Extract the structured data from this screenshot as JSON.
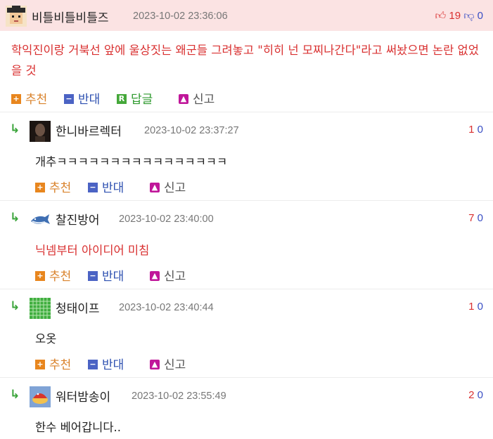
{
  "main_comment": {
    "nickname": "비틀비틀비틀즈",
    "date": "2023-10-02 23:36:06",
    "up_count": "19",
    "down_count": "0",
    "text": "학익진이랑 거북선 앞에 울상짓는 왜군들 그려놓고 \"히히 넌 모찌나간다\"라고 써놨으면 논란 없었을 것",
    "actions": {
      "recommend": "추천",
      "oppose": "반대",
      "reply": "답글",
      "report": "신고"
    }
  },
  "replies": [
    {
      "nickname": "한니바르렉터",
      "date": "2023-10-02 23:37:27",
      "up_count": "1",
      "down_count": "0",
      "text": "개추ㅋㅋㅋㅋㅋㅋㅋㅋㅋㅋㅋㅋㅋㅋㅋㅋ",
      "text_color": "#222222"
    },
    {
      "nickname": "찰진방어",
      "date": "2023-10-02 23:40:00",
      "up_count": "7",
      "down_count": "0",
      "text": "닉넴부터 아이디어 미침",
      "text_color": "#d93030"
    },
    {
      "nickname": "청태이프",
      "date": "2023-10-02 23:40:44",
      "up_count": "1",
      "down_count": "0",
      "text": "오옷",
      "text_color": "#222222"
    },
    {
      "nickname": "워터밤송이",
      "date": "2023-10-02 23:55:49",
      "up_count": "2",
      "down_count": "0",
      "text": "한수 베어갑니다..",
      "text_color": "#222222"
    }
  ],
  "reply_actions": {
    "recommend": "추천",
    "oppose": "반대",
    "report": "신고"
  },
  "colors": {
    "upvote": "#d93030",
    "downvote": "#3a4fc4",
    "highlight_bg": "#fbe3e3"
  }
}
